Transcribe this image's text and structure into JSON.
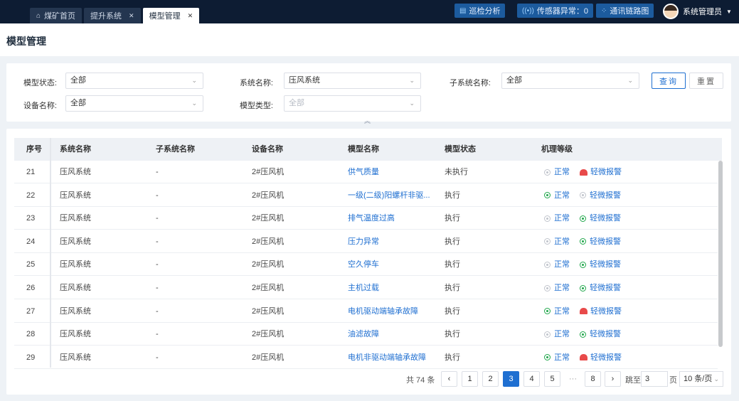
{
  "tabs": [
    {
      "label": "煤矿首页",
      "icon": "home-icon",
      "closable": false,
      "active": false
    },
    {
      "label": "提升系统",
      "closable": true,
      "active": false
    },
    {
      "label": "模型管理",
      "closable": true,
      "active": true
    }
  ],
  "topbar": {
    "patrol_label": "巡检分析",
    "sensor_label": "传感器异常：0",
    "comm_label": "通讯链路图",
    "user_name": "系统管理员"
  },
  "page_title": "模型管理",
  "filters": {
    "model_status_label": "模型状态:",
    "model_status_value": "全部",
    "system_name_label": "系统名称:",
    "system_name_value": "压风系统",
    "subsystem_name_label": "子系统名称:",
    "subsystem_name_value": "全部",
    "device_name_label": "设备名称:",
    "device_name_value": "全部",
    "model_type_label": "模型类型:",
    "model_type_value": "全部",
    "query_label": "查询",
    "reset_label": "重置"
  },
  "table": {
    "columns": [
      "序号",
      "系统名称",
      "子系统名称",
      "设备名称",
      "模型名称",
      "模型状态",
      "机理等级"
    ],
    "level_normal": "正常",
    "level_alarm": "轻微报警",
    "rows": [
      {
        "idx": "21",
        "system": "压风系统",
        "subsystem": "-",
        "device": "2#压风机",
        "model": "供气质量",
        "status": "未执行",
        "normal_state": "off",
        "alarm_state": "alarm"
      },
      {
        "idx": "22",
        "system": "压风系统",
        "subsystem": "-",
        "device": "2#压风机",
        "model": "一级(二级)阳螺杆非驱...",
        "status": "执行",
        "normal_state": "on",
        "alarm_state": "off"
      },
      {
        "idx": "23",
        "system": "压风系统",
        "subsystem": "-",
        "device": "2#压风机",
        "model": "排气温度过高",
        "status": "执行",
        "normal_state": "off",
        "alarm_state": "on"
      },
      {
        "idx": "24",
        "system": "压风系统",
        "subsystem": "-",
        "device": "2#压风机",
        "model": "压力异常",
        "status": "执行",
        "normal_state": "off",
        "alarm_state": "on"
      },
      {
        "idx": "25",
        "system": "压风系统",
        "subsystem": "-",
        "device": "2#压风机",
        "model": "空久停车",
        "status": "执行",
        "normal_state": "off",
        "alarm_state": "on"
      },
      {
        "idx": "26",
        "system": "压风系统",
        "subsystem": "-",
        "device": "2#压风机",
        "model": "主机过载",
        "status": "执行",
        "normal_state": "off",
        "alarm_state": "on"
      },
      {
        "idx": "27",
        "system": "压风系统",
        "subsystem": "-",
        "device": "2#压风机",
        "model": "电机驱动端轴承故障",
        "status": "执行",
        "normal_state": "on",
        "alarm_state": "alarm"
      },
      {
        "idx": "28",
        "system": "压风系统",
        "subsystem": "-",
        "device": "2#压风机",
        "model": "油滤故障",
        "status": "执行",
        "normal_state": "off",
        "alarm_state": "on"
      },
      {
        "idx": "29",
        "system": "压风系统",
        "subsystem": "-",
        "device": "2#压风机",
        "model": "电机非驱动端轴承故障",
        "status": "执行",
        "normal_state": "on",
        "alarm_state": "alarm"
      }
    ]
  },
  "pagination": {
    "total_text": "共 74 条",
    "pages": [
      "1",
      "2",
      "3",
      "4",
      "5",
      "···",
      "8"
    ],
    "current": "3",
    "jump_label": "跳至",
    "jump_value": "3",
    "page_suffix": "页",
    "page_size": "10 条/页"
  }
}
